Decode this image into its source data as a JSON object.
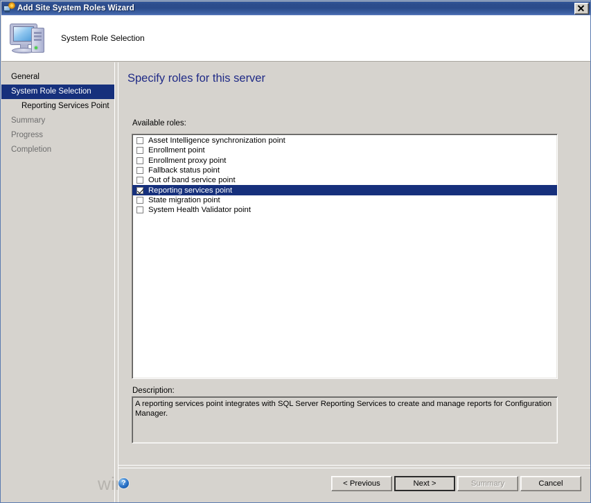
{
  "window": {
    "title": "Add Site System Roles Wizard",
    "title_icon": "computer-gear-icon",
    "close_label": "Close"
  },
  "header": {
    "title": "System Role Selection",
    "icon": "computer-icon"
  },
  "sidebar": {
    "items": [
      {
        "label": "General",
        "state": "normal",
        "indent": false
      },
      {
        "label": "System Role Selection",
        "state": "selected",
        "indent": false
      },
      {
        "label": "Reporting Services Point",
        "state": "normal",
        "indent": true
      },
      {
        "label": "Summary",
        "state": "dim",
        "indent": false
      },
      {
        "label": "Progress",
        "state": "dim",
        "indent": false
      },
      {
        "label": "Completion",
        "state": "dim",
        "indent": false
      }
    ]
  },
  "content": {
    "page_title": "Specify roles for this server",
    "available_label": "Available roles:",
    "roles": [
      {
        "label": "Asset Intelligence synchronization point",
        "checked": false,
        "selected": false
      },
      {
        "label": "Enrollment point",
        "checked": false,
        "selected": false
      },
      {
        "label": "Enrollment proxy point",
        "checked": false,
        "selected": false
      },
      {
        "label": "Fallback status point",
        "checked": false,
        "selected": false
      },
      {
        "label": "Out of band service point",
        "checked": false,
        "selected": false
      },
      {
        "label": "Reporting services point",
        "checked": true,
        "selected": true
      },
      {
        "label": "State migration point",
        "checked": false,
        "selected": false
      },
      {
        "label": "System Health Validator point",
        "checked": false,
        "selected": false
      }
    ],
    "description_label": "Description:",
    "description_text": "A reporting services point integrates with SQL Server Reporting Services to create and manage reports for Configuration Manager."
  },
  "footer": {
    "help_glyph": "?",
    "watermark": "windows-noob.com",
    "buttons": [
      {
        "id": "previous",
        "label": "< Previous",
        "state": "normal"
      },
      {
        "id": "next",
        "label": "Next >",
        "state": "default"
      },
      {
        "id": "summary",
        "label": "Summary",
        "state": "disabled"
      },
      {
        "id": "cancel",
        "label": "Cancel",
        "state": "normal"
      }
    ]
  },
  "colors": {
    "titlebar_blue": "#2b4b8b",
    "selection_navy": "#16307c",
    "heading_blue": "#1f2a86",
    "dialog_face": "#d6d3ce",
    "watermark_gray": "#b6b3ae"
  }
}
